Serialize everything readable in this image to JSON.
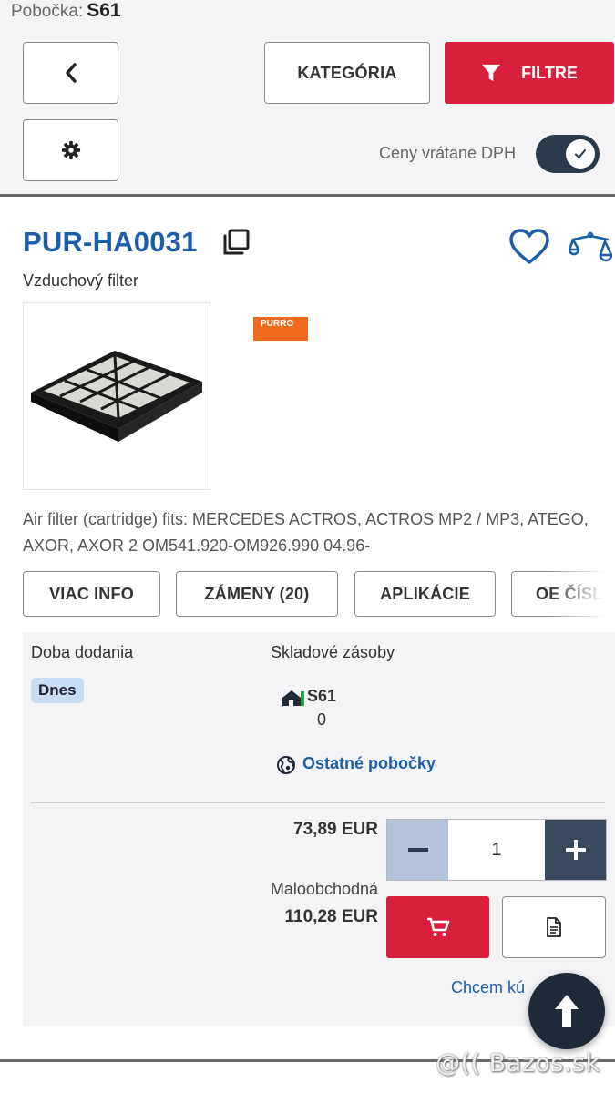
{
  "header": {
    "branch_label": "Pobočka:",
    "branch_code": "S61"
  },
  "toolbar": {
    "back_icon": "chevron-left-icon",
    "settings_icon": "gear-icon",
    "category_label": "KATEGÓRIA",
    "filter_label": "FILTRE",
    "vat_label": "Ceny vrátane DPH",
    "vat_toggle_on": true
  },
  "product": {
    "code": "PUR-HA0031",
    "name": "Vzduchový filter",
    "brand_logo_text": "PURRO",
    "brand_logo_subtext": "",
    "description": "Air filter (cartridge) fits: MERCEDES ACTROS, ACTROS MP2 / MP3, ATEGO, AXOR, AXOR 2 OM541.920-OM926.990 04.96-"
  },
  "tabs": [
    {
      "label": "VIAC INFO"
    },
    {
      "label": "ZÁMENY (20)"
    },
    {
      "label": "APLIKÁCIE"
    },
    {
      "label": "OE ČÍSLA"
    }
  ],
  "stock": {
    "delivery_label": "Doba dodania",
    "stock_label": "Skladové zásoby",
    "delivery_badge": "Dnes",
    "branch_code": "S61",
    "branch_qty": "0",
    "other_branches_label": "Ostatné pobočky"
  },
  "pricing": {
    "net_price": "73,89 EUR",
    "quantity": "1",
    "retail_label": "Maloobchodná",
    "retail_price": "110,28 EUR",
    "request_link": "Chcem kú"
  },
  "colors": {
    "accent_red": "#d81f3c",
    "link_blue": "#1c5ea8",
    "dark_navy": "#2b3a4a",
    "badge_blue": "#c8dcf3",
    "brand_orange": "#f06a1e"
  },
  "watermark": "@(( Bazos.sk"
}
